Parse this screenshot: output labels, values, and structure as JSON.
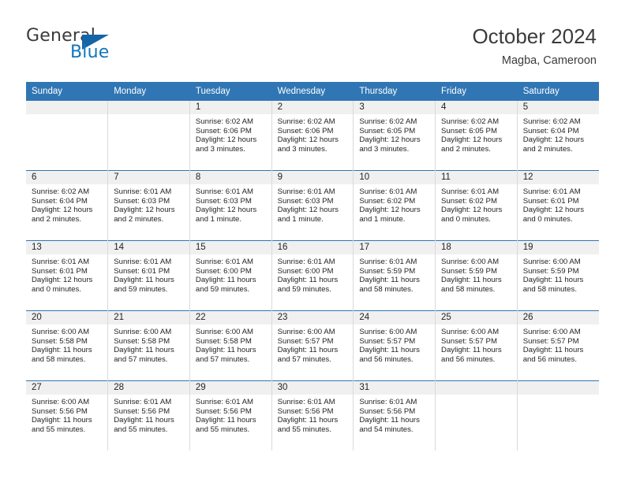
{
  "logo": {
    "word1": "General",
    "word2": "Blue",
    "triangle_color": "#1465a8",
    "blue_color": "#1277bc"
  },
  "header": {
    "title": "October 2024",
    "subtitle": "Magba, Cameroon"
  },
  "theme": {
    "header_bg": "#3076b4",
    "daynum_bg": "#f0f0f0",
    "text": "#231f20",
    "cell_border": "#d9d9d9"
  },
  "calendar": {
    "weekday_headers": [
      "Sunday",
      "Monday",
      "Tuesday",
      "Wednesday",
      "Thursday",
      "Friday",
      "Saturday"
    ],
    "weeks": [
      [
        {
          "day": "",
          "lines": []
        },
        {
          "day": "",
          "lines": []
        },
        {
          "day": "1",
          "lines": [
            "Sunrise: 6:02 AM",
            "Sunset: 6:06 PM",
            "Daylight: 12 hours",
            "and 3 minutes."
          ]
        },
        {
          "day": "2",
          "lines": [
            "Sunrise: 6:02 AM",
            "Sunset: 6:06 PM",
            "Daylight: 12 hours",
            "and 3 minutes."
          ]
        },
        {
          "day": "3",
          "lines": [
            "Sunrise: 6:02 AM",
            "Sunset: 6:05 PM",
            "Daylight: 12 hours",
            "and 3 minutes."
          ]
        },
        {
          "day": "4",
          "lines": [
            "Sunrise: 6:02 AM",
            "Sunset: 6:05 PM",
            "Daylight: 12 hours",
            "and 2 minutes."
          ]
        },
        {
          "day": "5",
          "lines": [
            "Sunrise: 6:02 AM",
            "Sunset: 6:04 PM",
            "Daylight: 12 hours",
            "and 2 minutes."
          ]
        }
      ],
      [
        {
          "day": "6",
          "lines": [
            "Sunrise: 6:02 AM",
            "Sunset: 6:04 PM",
            "Daylight: 12 hours",
            "and 2 minutes."
          ]
        },
        {
          "day": "7",
          "lines": [
            "Sunrise: 6:01 AM",
            "Sunset: 6:03 PM",
            "Daylight: 12 hours",
            "and 2 minutes."
          ]
        },
        {
          "day": "8",
          "lines": [
            "Sunrise: 6:01 AM",
            "Sunset: 6:03 PM",
            "Daylight: 12 hours",
            "and 1 minute."
          ]
        },
        {
          "day": "9",
          "lines": [
            "Sunrise: 6:01 AM",
            "Sunset: 6:03 PM",
            "Daylight: 12 hours",
            "and 1 minute."
          ]
        },
        {
          "day": "10",
          "lines": [
            "Sunrise: 6:01 AM",
            "Sunset: 6:02 PM",
            "Daylight: 12 hours",
            "and 1 minute."
          ]
        },
        {
          "day": "11",
          "lines": [
            "Sunrise: 6:01 AM",
            "Sunset: 6:02 PM",
            "Daylight: 12 hours",
            "and 0 minutes."
          ]
        },
        {
          "day": "12",
          "lines": [
            "Sunrise: 6:01 AM",
            "Sunset: 6:01 PM",
            "Daylight: 12 hours",
            "and 0 minutes."
          ]
        }
      ],
      [
        {
          "day": "13",
          "lines": [
            "Sunrise: 6:01 AM",
            "Sunset: 6:01 PM",
            "Daylight: 12 hours",
            "and 0 minutes."
          ]
        },
        {
          "day": "14",
          "lines": [
            "Sunrise: 6:01 AM",
            "Sunset: 6:01 PM",
            "Daylight: 11 hours",
            "and 59 minutes."
          ]
        },
        {
          "day": "15",
          "lines": [
            "Sunrise: 6:01 AM",
            "Sunset: 6:00 PM",
            "Daylight: 11 hours",
            "and 59 minutes."
          ]
        },
        {
          "day": "16",
          "lines": [
            "Sunrise: 6:01 AM",
            "Sunset: 6:00 PM",
            "Daylight: 11 hours",
            "and 59 minutes."
          ]
        },
        {
          "day": "17",
          "lines": [
            "Sunrise: 6:01 AM",
            "Sunset: 5:59 PM",
            "Daylight: 11 hours",
            "and 58 minutes."
          ]
        },
        {
          "day": "18",
          "lines": [
            "Sunrise: 6:00 AM",
            "Sunset: 5:59 PM",
            "Daylight: 11 hours",
            "and 58 minutes."
          ]
        },
        {
          "day": "19",
          "lines": [
            "Sunrise: 6:00 AM",
            "Sunset: 5:59 PM",
            "Daylight: 11 hours",
            "and 58 minutes."
          ]
        }
      ],
      [
        {
          "day": "20",
          "lines": [
            "Sunrise: 6:00 AM",
            "Sunset: 5:58 PM",
            "Daylight: 11 hours",
            "and 58 minutes."
          ]
        },
        {
          "day": "21",
          "lines": [
            "Sunrise: 6:00 AM",
            "Sunset: 5:58 PM",
            "Daylight: 11 hours",
            "and 57 minutes."
          ]
        },
        {
          "day": "22",
          "lines": [
            "Sunrise: 6:00 AM",
            "Sunset: 5:58 PM",
            "Daylight: 11 hours",
            "and 57 minutes."
          ]
        },
        {
          "day": "23",
          "lines": [
            "Sunrise: 6:00 AM",
            "Sunset: 5:57 PM",
            "Daylight: 11 hours",
            "and 57 minutes."
          ]
        },
        {
          "day": "24",
          "lines": [
            "Sunrise: 6:00 AM",
            "Sunset: 5:57 PM",
            "Daylight: 11 hours",
            "and 56 minutes."
          ]
        },
        {
          "day": "25",
          "lines": [
            "Sunrise: 6:00 AM",
            "Sunset: 5:57 PM",
            "Daylight: 11 hours",
            "and 56 minutes."
          ]
        },
        {
          "day": "26",
          "lines": [
            "Sunrise: 6:00 AM",
            "Sunset: 5:57 PM",
            "Daylight: 11 hours",
            "and 56 minutes."
          ]
        }
      ],
      [
        {
          "day": "27",
          "lines": [
            "Sunrise: 6:00 AM",
            "Sunset: 5:56 PM",
            "Daylight: 11 hours",
            "and 55 minutes."
          ]
        },
        {
          "day": "28",
          "lines": [
            "Sunrise: 6:01 AM",
            "Sunset: 5:56 PM",
            "Daylight: 11 hours",
            "and 55 minutes."
          ]
        },
        {
          "day": "29",
          "lines": [
            "Sunrise: 6:01 AM",
            "Sunset: 5:56 PM",
            "Daylight: 11 hours",
            "and 55 minutes."
          ]
        },
        {
          "day": "30",
          "lines": [
            "Sunrise: 6:01 AM",
            "Sunset: 5:56 PM",
            "Daylight: 11 hours",
            "and 55 minutes."
          ]
        },
        {
          "day": "31",
          "lines": [
            "Sunrise: 6:01 AM",
            "Sunset: 5:56 PM",
            "Daylight: 11 hours",
            "and 54 minutes."
          ]
        },
        {
          "day": "",
          "lines": []
        },
        {
          "day": "",
          "lines": []
        }
      ]
    ]
  }
}
